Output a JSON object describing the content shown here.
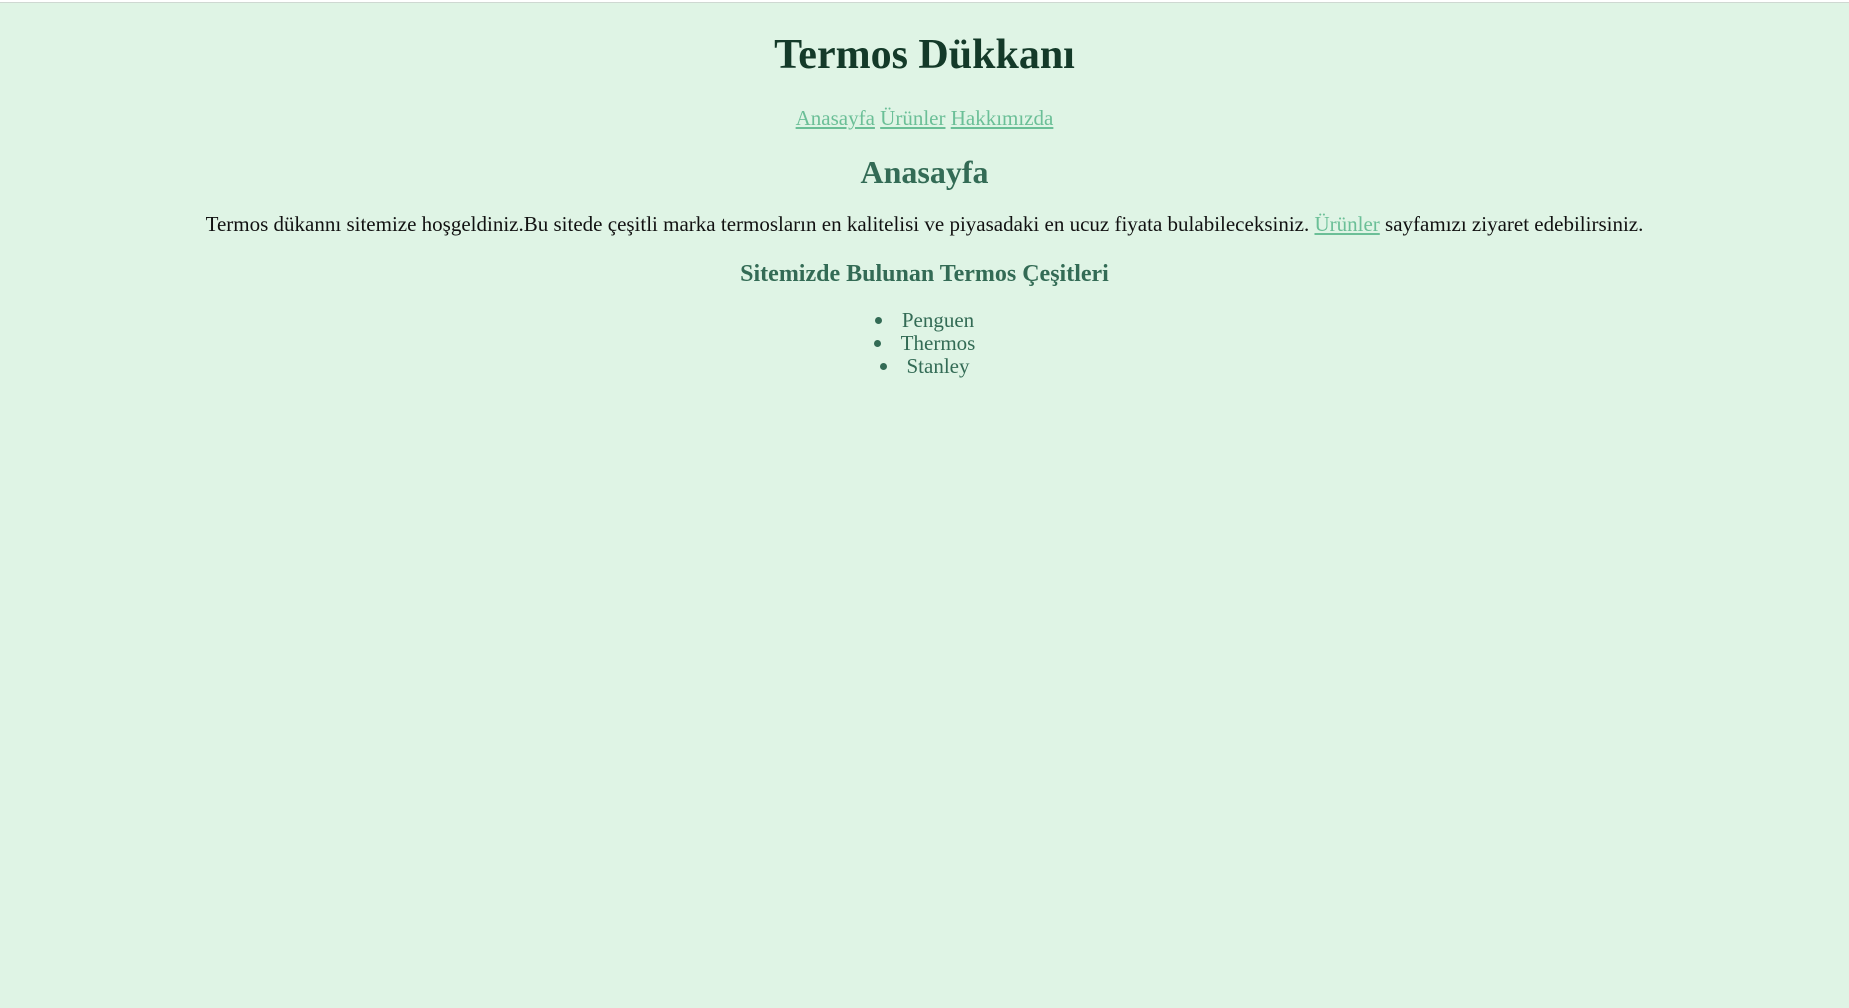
{
  "site": {
    "title": "Termos Dükkanı"
  },
  "nav": {
    "items": [
      "Anasayfa",
      "Ürünler",
      "Hakkımızda"
    ]
  },
  "main": {
    "heading": "Anasayfa",
    "intro_before": "Termos dükannı sitemize hoşgeldiniz.Bu sitede çeşitli marka termosların en kalitelisi ve piyasadaki en ucuz fiyata bulabileceksiniz.",
    "intro_link": "Ürünler",
    "intro_after": "sayfamızı ziyaret edebilirsiniz.",
    "section_heading": "Sitemizde Bulunan Termos Çeşitleri",
    "brands": [
      "Penguen",
      "Thermos",
      "Stanley"
    ]
  },
  "colors": {
    "background": "#dff4e5",
    "title": "#143a29",
    "heading": "#336b55",
    "link": "#6bbf97",
    "body_text": "#111111"
  }
}
